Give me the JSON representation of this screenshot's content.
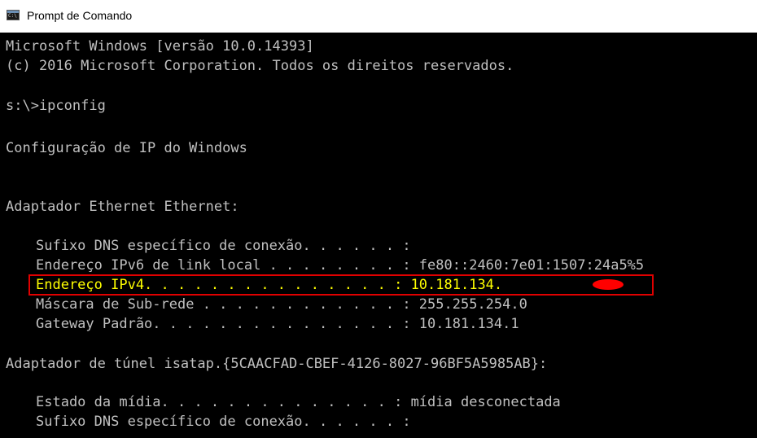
{
  "window": {
    "title": "Prompt de Comando",
    "icon": "cmd-icon",
    "icon_text": "C:\\"
  },
  "console": {
    "lines": [
      "Microsoft Windows [versão 10.0.14393]",
      "(c) 2016 Microsoft Corporation. Todos os direitos reservados.",
      "s:\\>ipconfig",
      "Configuração de IP do Windows",
      "Adaptador Ethernet Ethernet:",
      "Sufixo DNS específico de conexão. . . . . . :",
      "Endereço IPv6 de link local . . . . . . . . : fe80::2460:7e01:1507:24a5%5",
      "Endereço IPv4. . . . . . . . . . . . . . . : 10.181.134.",
      "Máscara de Sub-rede . . . . . . . . . . . . : 255.255.254.0",
      "Gateway Padrão. . . . . . . . . . . . . . . : 10.181.134.1",
      "Adaptador de túnel isatap.{5CAACFAD-CBEF-4126-8027-96BF5A5985AB}:",
      "Estado da mídia. . . . . . . . . . . . . . : mídia desconectada",
      "Sufixo DNS específico de conexão. . . . . . :"
    ]
  },
  "colors": {
    "console_background": "#000000",
    "console_text": "#c0c0c0",
    "highlighted_text": "#ffff00",
    "highlight_border": "#e00000",
    "redaction": "#ff0000"
  }
}
